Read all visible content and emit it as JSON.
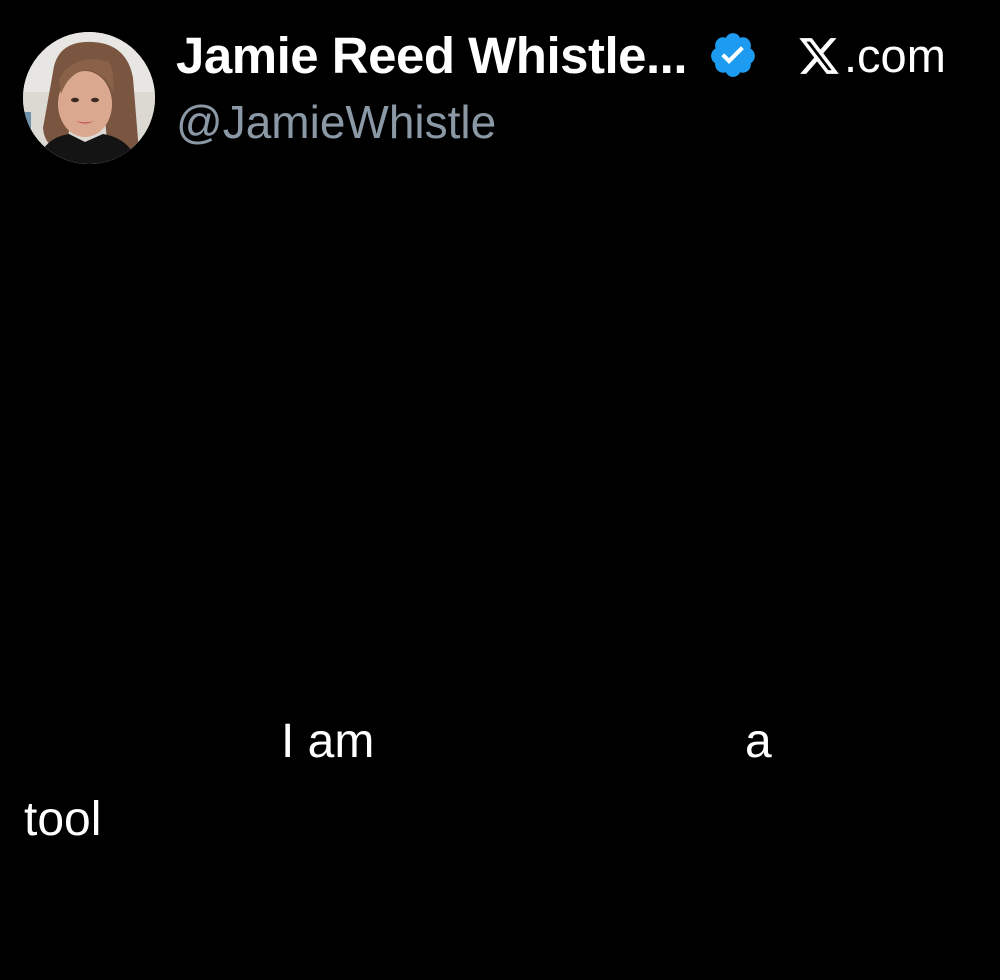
{
  "post": {
    "author": {
      "display_name": "Jamie Reed Whistle...",
      "handle": "@JamieWhistle",
      "verified": true,
      "verified_icon": "verified-badge-icon",
      "avatar_icon": "profile-photo"
    },
    "brand": {
      "logo_icon": "x-logo-icon",
      "suffix": ".com"
    },
    "visible_text_fragments": [
      "I am",
      "a",
      "tool"
    ]
  },
  "colors": {
    "background": "#000000",
    "primary_text": "#ffffff",
    "secondary_text": "#8b98a5",
    "verified_blue": "#1d9bf0"
  }
}
